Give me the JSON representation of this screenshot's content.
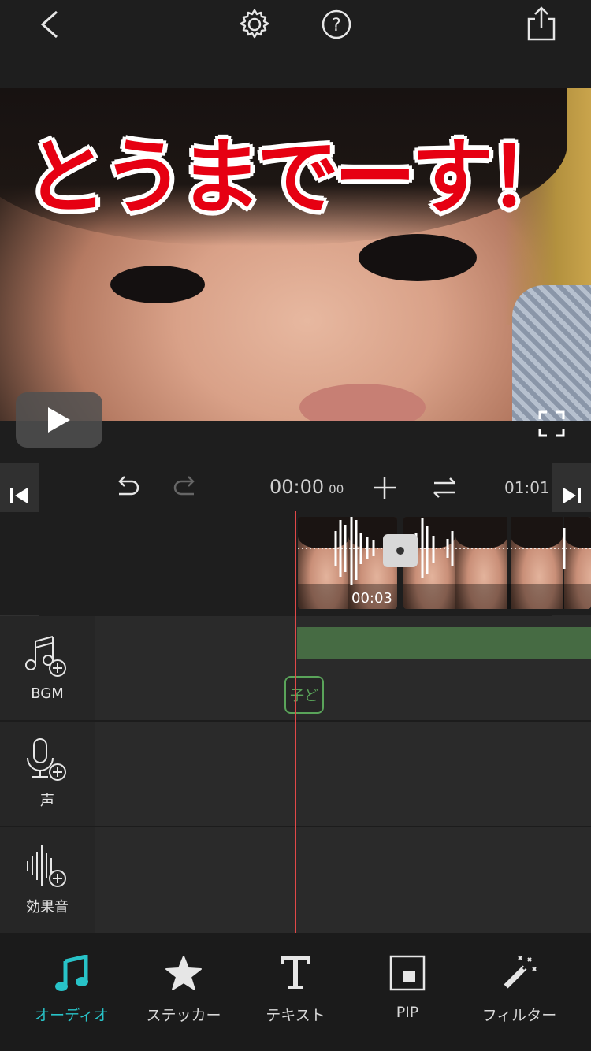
{
  "toolbar": {
    "back_icon": "chevron-left-icon",
    "settings_icon": "gear-icon",
    "help_icon": "question-circle-icon",
    "share_icon": "share-icon"
  },
  "preview": {
    "caption": "とうまでーす！",
    "caption_color": "#e60012",
    "play_icon": "play-icon",
    "fullscreen_icon": "fullscreen-icon"
  },
  "timeline": {
    "current_time": "00:00",
    "current_frames": "00",
    "total_time": "01:01",
    "clip_duration": "00:03"
  },
  "tracks": [
    {
      "label": "BGM",
      "icon": "music-note-add-icon",
      "marker": "子ど"
    },
    {
      "label": "声",
      "icon": "microphone-add-icon"
    },
    {
      "label": "効果音",
      "icon": "waveform-add-icon"
    }
  ],
  "tabs": [
    {
      "label": "オーディオ",
      "icon": "music-icon",
      "active": true
    },
    {
      "label": "ステッカー",
      "icon": "star-icon"
    },
    {
      "label": "テキスト",
      "icon": "text-icon"
    },
    {
      "label": "PIP",
      "icon": "pip-icon"
    },
    {
      "label": "フィルター",
      "icon": "magic-wand-icon"
    }
  ],
  "colors": {
    "accent": "#28c3c8",
    "playhead": "#e04848",
    "bgm_track": "#466b43"
  }
}
